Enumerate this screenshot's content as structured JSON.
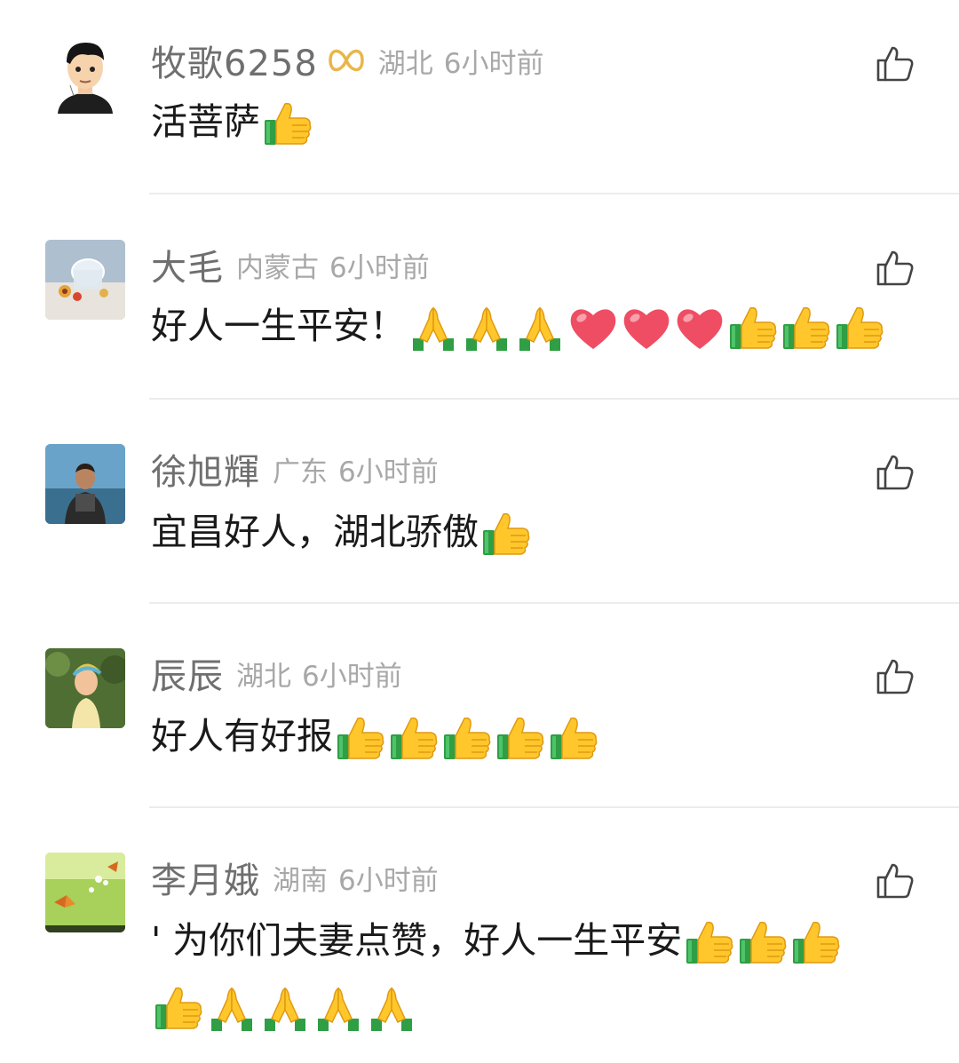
{
  "comments": [
    {
      "name": "牧歌6258",
      "has_badge": true,
      "region": "湖北",
      "time": "6小时前",
      "text": "活菩萨",
      "emojis": [
        "thumbs-up"
      ]
    },
    {
      "name": "大毛",
      "region": "内蒙古",
      "time": "6小时前",
      "text": "好人一生平安！",
      "emojis": [
        "pray",
        "pray",
        "pray",
        "heart",
        "heart",
        "heart",
        "thumbs-up",
        "thumbs-up",
        "thumbs-up"
      ]
    },
    {
      "name": "徐旭輝",
      "region": "广东",
      "time": "6小时前",
      "text": "宜昌好人，湖北骄傲",
      "emojis": [
        "thumbs-up"
      ]
    },
    {
      "name": "辰辰",
      "region": "湖北",
      "time": "6小时前",
      "text": "好人有好报",
      "emojis": [
        "thumbs-up",
        "thumbs-up",
        "thumbs-up",
        "thumbs-up",
        "thumbs-up"
      ]
    },
    {
      "name": "李月娥",
      "region": "湖南",
      "time": "6小时前",
      "text": "' 为你们夫妻点赞，好人一生平安",
      "emojis": [
        "thumbs-up",
        "thumbs-up",
        "thumbs-up"
      ],
      "text_line2": "",
      "emojis_line2": [
        "thumbs-up",
        "pray",
        "pray",
        "pray",
        "pray"
      ]
    }
  ],
  "colors": {
    "name": "#6f6f6f",
    "meta": "#a8a8a8",
    "text": "#1a1a1a",
    "divider": "#ececec",
    "badge": "#e8b64a"
  }
}
